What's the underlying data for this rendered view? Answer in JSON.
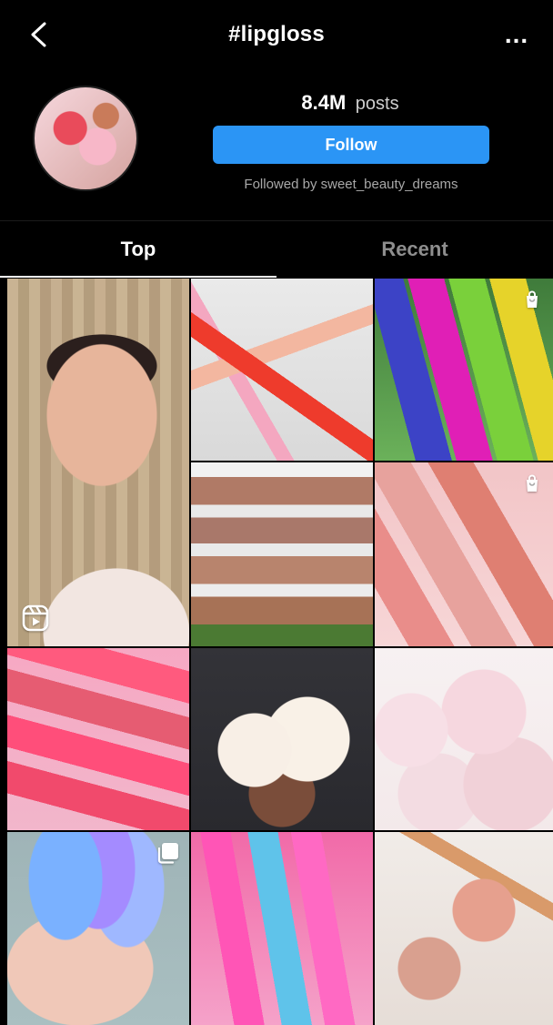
{
  "header": {
    "title": "#lipgloss",
    "more_label": "...",
    "back_icon": "chevron-left-icon"
  },
  "profile": {
    "post_count": "8.4M",
    "post_label": "posts",
    "follow_label": "Follow",
    "followed_by_text": "Followed by sweet_beauty_dreams",
    "accent_color": "#2b95f5"
  },
  "tabs": [
    {
      "label": "Top",
      "state": "active"
    },
    {
      "label": "Recent",
      "state": "inactive"
    }
  ],
  "grid": {
    "tiles": [
      {
        "overlay_icon": "reels-icon"
      },
      {
        "overlay_icon": ""
      },
      {
        "overlay_icon": "shopping-bag-icon"
      },
      {
        "overlay_icon": ""
      },
      {
        "overlay_icon": "shopping-bag-icon"
      },
      {
        "overlay_icon": ""
      },
      {
        "overlay_icon": ""
      },
      {
        "overlay_icon": ""
      },
      {
        "overlay_icon": "carousel-icon"
      },
      {
        "overlay_icon": ""
      },
      {
        "overlay_icon": ""
      }
    ]
  },
  "theme": {
    "background": "#000000",
    "text_primary": "#ffffff",
    "text_secondary": "#a8a8a8",
    "tab_inactive": "#8e8e8e"
  }
}
